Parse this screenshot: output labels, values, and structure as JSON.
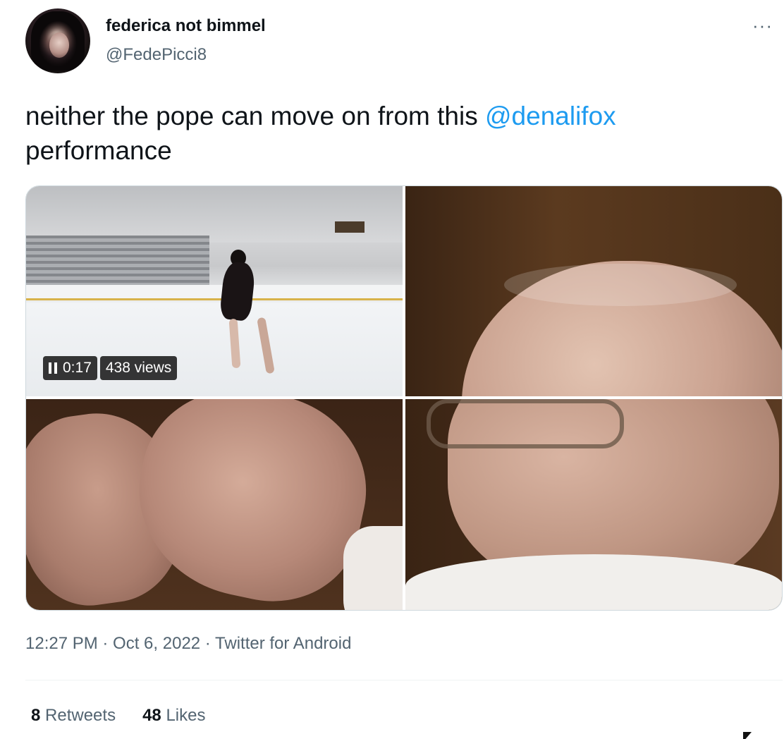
{
  "author": {
    "name": "federica not bimmel",
    "handle": "@FedePicci8"
  },
  "more_icon": "more-horizontal-icon",
  "tweet": {
    "text_before": "neither the pope can move on from this ",
    "mention": "@denalifox",
    "text_after": "performance"
  },
  "video": {
    "time": "0:17",
    "views": "438 views",
    "pause_icon": "pause-icon"
  },
  "meta": {
    "text": "12:27 PM · Oct 6, 2022 · Twitter for Android"
  },
  "stats": {
    "retweets_count": "8",
    "retweets_label": "Retweets",
    "likes_count": "48",
    "likes_label": "Likes"
  },
  "colors": {
    "link": "#1d9bf0",
    "secondary_text": "#536471",
    "primary_text": "#0f1419"
  }
}
